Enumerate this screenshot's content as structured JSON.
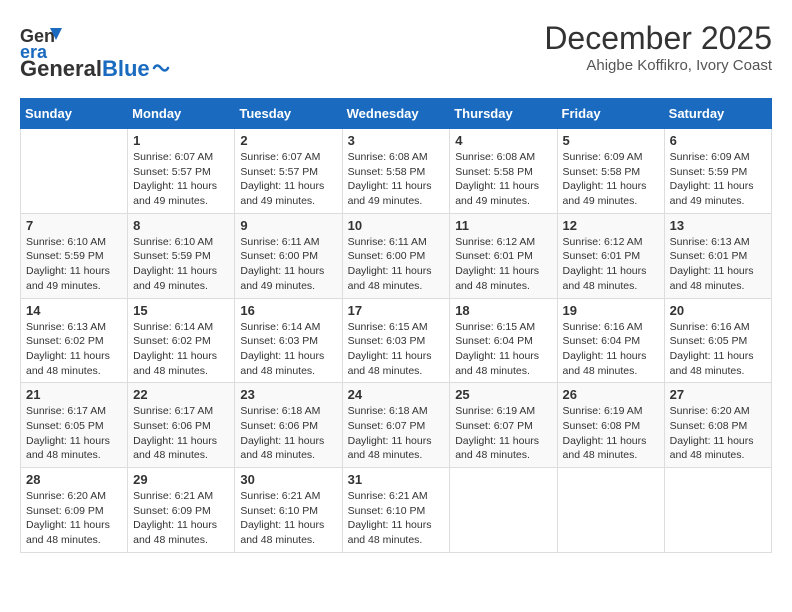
{
  "header": {
    "logo_general": "General",
    "logo_blue": "Blue",
    "month": "December 2025",
    "location": "Ahigbe Koffikro, Ivory Coast"
  },
  "days_of_week": [
    "Sunday",
    "Monday",
    "Tuesday",
    "Wednesday",
    "Thursday",
    "Friday",
    "Saturday"
  ],
  "weeks": [
    [
      {
        "day": "",
        "sunrise": "",
        "sunset": "",
        "daylight": ""
      },
      {
        "day": "1",
        "sunrise": "Sunrise: 6:07 AM",
        "sunset": "Sunset: 5:57 PM",
        "daylight": "Daylight: 11 hours and 49 minutes."
      },
      {
        "day": "2",
        "sunrise": "Sunrise: 6:07 AM",
        "sunset": "Sunset: 5:57 PM",
        "daylight": "Daylight: 11 hours and 49 minutes."
      },
      {
        "day": "3",
        "sunrise": "Sunrise: 6:08 AM",
        "sunset": "Sunset: 5:58 PM",
        "daylight": "Daylight: 11 hours and 49 minutes."
      },
      {
        "day": "4",
        "sunrise": "Sunrise: 6:08 AM",
        "sunset": "Sunset: 5:58 PM",
        "daylight": "Daylight: 11 hours and 49 minutes."
      },
      {
        "day": "5",
        "sunrise": "Sunrise: 6:09 AM",
        "sunset": "Sunset: 5:58 PM",
        "daylight": "Daylight: 11 hours and 49 minutes."
      },
      {
        "day": "6",
        "sunrise": "Sunrise: 6:09 AM",
        "sunset": "Sunset: 5:59 PM",
        "daylight": "Daylight: 11 hours and 49 minutes."
      }
    ],
    [
      {
        "day": "7",
        "sunrise": "Sunrise: 6:10 AM",
        "sunset": "Sunset: 5:59 PM",
        "daylight": "Daylight: 11 hours and 49 minutes."
      },
      {
        "day": "8",
        "sunrise": "Sunrise: 6:10 AM",
        "sunset": "Sunset: 5:59 PM",
        "daylight": "Daylight: 11 hours and 49 minutes."
      },
      {
        "day": "9",
        "sunrise": "Sunrise: 6:11 AM",
        "sunset": "Sunset: 6:00 PM",
        "daylight": "Daylight: 11 hours and 49 minutes."
      },
      {
        "day": "10",
        "sunrise": "Sunrise: 6:11 AM",
        "sunset": "Sunset: 6:00 PM",
        "daylight": "Daylight: 11 hours and 48 minutes."
      },
      {
        "day": "11",
        "sunrise": "Sunrise: 6:12 AM",
        "sunset": "Sunset: 6:01 PM",
        "daylight": "Daylight: 11 hours and 48 minutes."
      },
      {
        "day": "12",
        "sunrise": "Sunrise: 6:12 AM",
        "sunset": "Sunset: 6:01 PM",
        "daylight": "Daylight: 11 hours and 48 minutes."
      },
      {
        "day": "13",
        "sunrise": "Sunrise: 6:13 AM",
        "sunset": "Sunset: 6:01 PM",
        "daylight": "Daylight: 11 hours and 48 minutes."
      }
    ],
    [
      {
        "day": "14",
        "sunrise": "Sunrise: 6:13 AM",
        "sunset": "Sunset: 6:02 PM",
        "daylight": "Daylight: 11 hours and 48 minutes."
      },
      {
        "day": "15",
        "sunrise": "Sunrise: 6:14 AM",
        "sunset": "Sunset: 6:02 PM",
        "daylight": "Daylight: 11 hours and 48 minutes."
      },
      {
        "day": "16",
        "sunrise": "Sunrise: 6:14 AM",
        "sunset": "Sunset: 6:03 PM",
        "daylight": "Daylight: 11 hours and 48 minutes."
      },
      {
        "day": "17",
        "sunrise": "Sunrise: 6:15 AM",
        "sunset": "Sunset: 6:03 PM",
        "daylight": "Daylight: 11 hours and 48 minutes."
      },
      {
        "day": "18",
        "sunrise": "Sunrise: 6:15 AM",
        "sunset": "Sunset: 6:04 PM",
        "daylight": "Daylight: 11 hours and 48 minutes."
      },
      {
        "day": "19",
        "sunrise": "Sunrise: 6:16 AM",
        "sunset": "Sunset: 6:04 PM",
        "daylight": "Daylight: 11 hours and 48 minutes."
      },
      {
        "day": "20",
        "sunrise": "Sunrise: 6:16 AM",
        "sunset": "Sunset: 6:05 PM",
        "daylight": "Daylight: 11 hours and 48 minutes."
      }
    ],
    [
      {
        "day": "21",
        "sunrise": "Sunrise: 6:17 AM",
        "sunset": "Sunset: 6:05 PM",
        "daylight": "Daylight: 11 hours and 48 minutes."
      },
      {
        "day": "22",
        "sunrise": "Sunrise: 6:17 AM",
        "sunset": "Sunset: 6:06 PM",
        "daylight": "Daylight: 11 hours and 48 minutes."
      },
      {
        "day": "23",
        "sunrise": "Sunrise: 6:18 AM",
        "sunset": "Sunset: 6:06 PM",
        "daylight": "Daylight: 11 hours and 48 minutes."
      },
      {
        "day": "24",
        "sunrise": "Sunrise: 6:18 AM",
        "sunset": "Sunset: 6:07 PM",
        "daylight": "Daylight: 11 hours and 48 minutes."
      },
      {
        "day": "25",
        "sunrise": "Sunrise: 6:19 AM",
        "sunset": "Sunset: 6:07 PM",
        "daylight": "Daylight: 11 hours and 48 minutes."
      },
      {
        "day": "26",
        "sunrise": "Sunrise: 6:19 AM",
        "sunset": "Sunset: 6:08 PM",
        "daylight": "Daylight: 11 hours and 48 minutes."
      },
      {
        "day": "27",
        "sunrise": "Sunrise: 6:20 AM",
        "sunset": "Sunset: 6:08 PM",
        "daylight": "Daylight: 11 hours and 48 minutes."
      }
    ],
    [
      {
        "day": "28",
        "sunrise": "Sunrise: 6:20 AM",
        "sunset": "Sunset: 6:09 PM",
        "daylight": "Daylight: 11 hours and 48 minutes."
      },
      {
        "day": "29",
        "sunrise": "Sunrise: 6:21 AM",
        "sunset": "Sunset: 6:09 PM",
        "daylight": "Daylight: 11 hours and 48 minutes."
      },
      {
        "day": "30",
        "sunrise": "Sunrise: 6:21 AM",
        "sunset": "Sunset: 6:10 PM",
        "daylight": "Daylight: 11 hours and 48 minutes."
      },
      {
        "day": "31",
        "sunrise": "Sunrise: 6:21 AM",
        "sunset": "Sunset: 6:10 PM",
        "daylight": "Daylight: 11 hours and 48 minutes."
      },
      {
        "day": "",
        "sunrise": "",
        "sunset": "",
        "daylight": ""
      },
      {
        "day": "",
        "sunrise": "",
        "sunset": "",
        "daylight": ""
      },
      {
        "day": "",
        "sunrise": "",
        "sunset": "",
        "daylight": ""
      }
    ]
  ]
}
